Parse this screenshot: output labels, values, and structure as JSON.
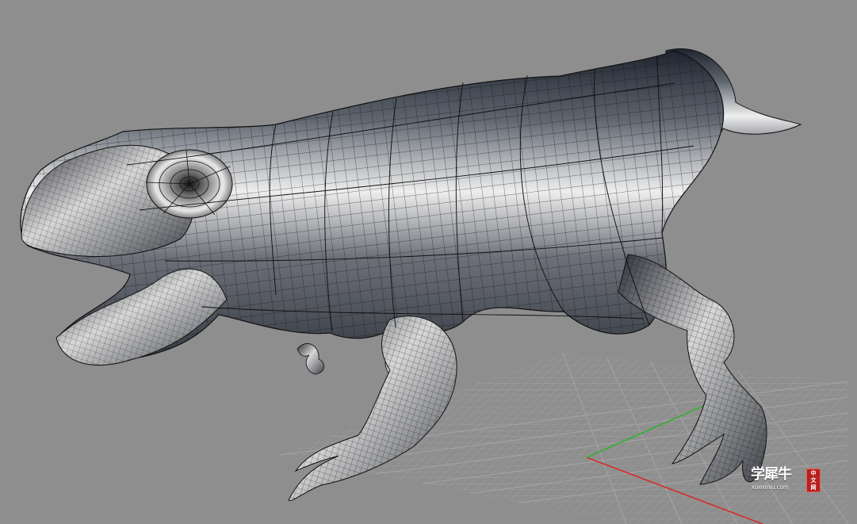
{
  "viewport": {
    "background_color": "#8e8e8e",
    "grid_color": "#a3a3a3",
    "axis_x_color": "#e11e1e",
    "axis_y_color": "#27b427",
    "model_fill_color": "#555a61",
    "model_highlight_color": "#f4f4f4",
    "wire_color": "#0b0b0b"
  },
  "watermark": {
    "title": "学犀牛",
    "domain": "xuexiniu.com",
    "badge_line_1": "中",
    "badge_line_2": "文",
    "badge_line_3": "网",
    "badge_color": "#b7211c"
  }
}
